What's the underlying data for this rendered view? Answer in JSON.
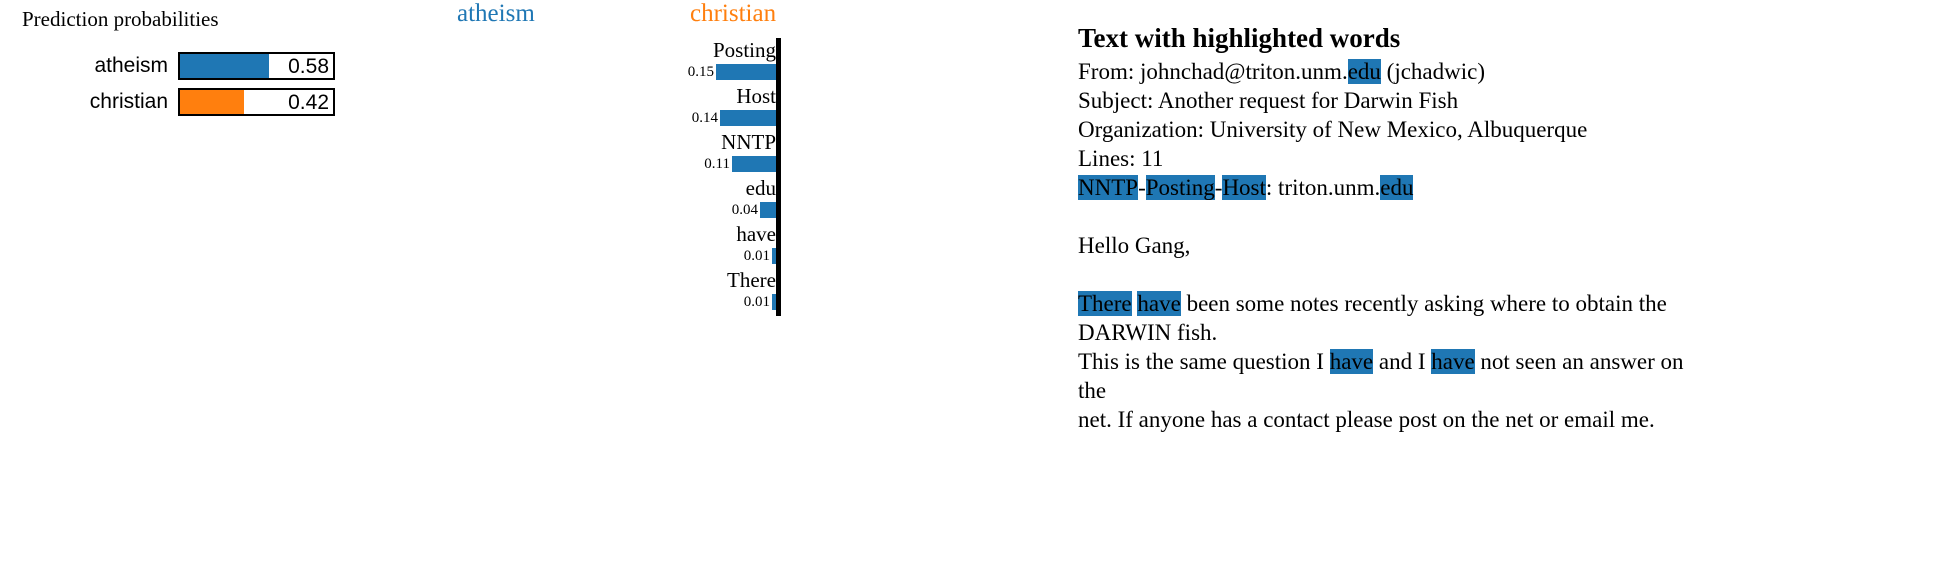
{
  "prediction_probabilities": {
    "title": "Prediction probabilities",
    "rows": [
      {
        "label": "atheism",
        "value": "0.58",
        "fraction": 0.58,
        "color": "#1f77b4"
      },
      {
        "label": "christian",
        "value": "0.42",
        "fraction": 0.42,
        "color": "#ff7f0e"
      }
    ]
  },
  "class_headers": {
    "left": {
      "label": "atheism",
      "color": "#1f77b4"
    },
    "right": {
      "label": "christian",
      "color": "#ff7f0e"
    }
  },
  "chart_data": {
    "type": "bar",
    "title": "",
    "orientation": "horizontal-left",
    "xlabel": "",
    "ylabel": "",
    "note": "LIME local feature weights; all bars point left toward the 'atheism' class",
    "categories": [
      "Posting",
      "Host",
      "NNTP",
      "edu",
      "have",
      "There"
    ],
    "values": [
      0.15,
      0.14,
      0.11,
      0.04,
      0.01,
      0.01
    ],
    "value_labels": [
      "0.15",
      "0.14",
      "0.11",
      "0.04",
      "0.01",
      "0.01"
    ],
    "series": [
      {
        "name": "atheism",
        "color": "#1f77b4",
        "values": [
          0.15,
          0.14,
          0.11,
          0.04,
          0.01,
          0.01
        ]
      }
    ],
    "legend": [
      "atheism",
      "christian"
    ],
    "legend_position": "top",
    "grid": false,
    "xlim": [
      0,
      0.16
    ]
  },
  "text_panel": {
    "heading": "Text with highlighted words",
    "highlight_color": "#1f77b4",
    "lines": [
      [
        {
          "t": "From: johnchad@triton.unm.",
          "h": false
        },
        {
          "t": "edu",
          "h": true
        },
        {
          "t": " (jchadwic)",
          "h": false
        }
      ],
      [
        {
          "t": "Subject: Another request for Darwin Fish",
          "h": false
        }
      ],
      [
        {
          "t": "Organization: University of New Mexico, Albuquerque",
          "h": false
        }
      ],
      [
        {
          "t": "Lines: 11",
          "h": false
        }
      ],
      [
        {
          "t": "NNTP",
          "h": true
        },
        {
          "t": "-",
          "h": false
        },
        {
          "t": "Posting",
          "h": true
        },
        {
          "t": "-",
          "h": false
        },
        {
          "t": "Host",
          "h": true
        },
        {
          "t": ": triton.unm.",
          "h": false
        },
        {
          "t": "edu",
          "h": true
        }
      ],
      [],
      [
        {
          "t": "Hello Gang,",
          "h": false
        }
      ],
      [],
      [
        {
          "t": "There",
          "h": true
        },
        {
          "t": " ",
          "h": false
        },
        {
          "t": "have",
          "h": true
        },
        {
          "t": " been some notes recently asking where to obtain the",
          "h": false
        }
      ],
      [
        {
          "t": "DARWIN fish.",
          "h": false
        }
      ],
      [
        {
          "t": "This is the same question I ",
          "h": false
        },
        {
          "t": "have",
          "h": true
        },
        {
          "t": " and I ",
          "h": false
        },
        {
          "t": "have",
          "h": true
        },
        {
          "t": " not seen an answer on",
          "h": false
        }
      ],
      [
        {
          "t": "the",
          "h": false
        }
      ],
      [
        {
          "t": "net. If anyone has a contact please post on the net or email me.",
          "h": false
        }
      ]
    ]
  }
}
